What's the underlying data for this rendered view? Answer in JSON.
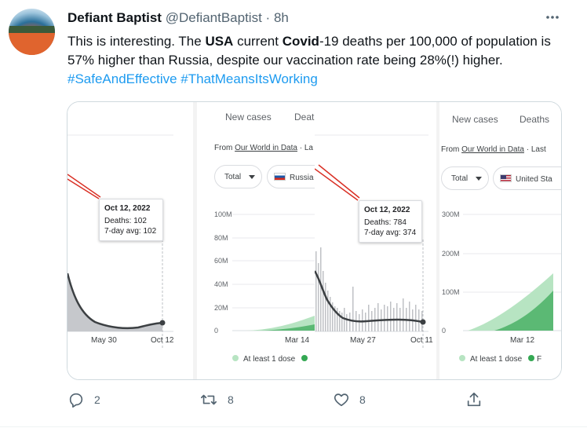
{
  "tweet": {
    "author_name": "Defiant Baptist",
    "handle": "@DefiantBaptist",
    "separator": "·",
    "time": "8h",
    "more_icon": "ellipsis-icon",
    "text": {
      "t1": "This is interesting. The ",
      "b1": "USA",
      "t2": " current ",
      "b2": "Covid",
      "t3": "-19 deaths per 100,000 of population is 57% higher than Russia, despite our vaccination rate being 28%(!) higher. ",
      "hashtag1": "#SafeAndEffective",
      "hashtag2": "#ThatMeansItsWorking"
    }
  },
  "media": {
    "panel1": {
      "tooltip_date": "Oct 12, 2022",
      "tooltip_deaths": "Deaths: 102",
      "tooltip_avg": "7-day avg: 102",
      "x_labels": [
        "May 30",
        "Oct 12"
      ]
    },
    "panel2": {
      "tab_new_cases": "New cases",
      "tab_deaths": "Deat",
      "source_prefix": "From ",
      "source_link": "Our World in Data",
      "source_suffix": " · La",
      "chip_total": "Total",
      "chip_country": "Russia",
      "y_labels": [
        "100M",
        "80M",
        "60M",
        "40M",
        "20M",
        "0"
      ],
      "x_label": "Mar 14",
      "legend": "At least 1 dose"
    },
    "panel3": {
      "tooltip_date": "Oct 12, 2022",
      "tooltip_deaths": "Deaths: 784",
      "tooltip_avg": "7-day avg: 374",
      "x_labels": [
        "May 27",
        "Oct 11"
      ]
    },
    "panel4": {
      "tab_new_cases": "New cases",
      "tab_deaths": "Deaths",
      "source_prefix": "From ",
      "source_link": "Our World in Data",
      "source_suffix": " · Last",
      "chip_total": "Total",
      "chip_country": "United Sta",
      "y_labels": [
        "300M",
        "200M",
        "100M",
        "0"
      ],
      "x_label": "Mar 12",
      "legend": "At least 1 dose",
      "legend2": "F"
    }
  },
  "actions": {
    "reply_count": "2",
    "retweet_count": "8",
    "like_count": "8"
  },
  "colors": {
    "link": "#1d9bf0",
    "area_gray": "#c6c8cc",
    "line_dark": "#3c4043",
    "vax_light": "#b7e4c2",
    "vax_dark": "#5bb974",
    "pointer_red": "#d93025"
  }
}
